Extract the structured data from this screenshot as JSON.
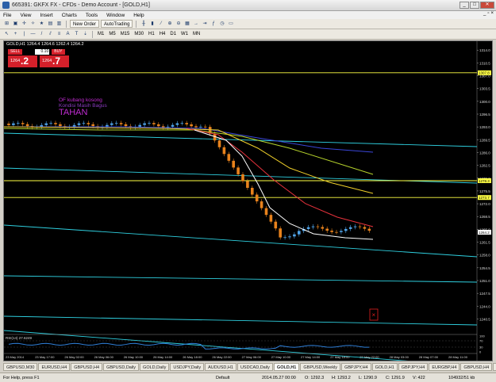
{
  "window": {
    "title": "665391: GKFX FX - CFDs - Demo Account - [GOLD,H1]",
    "min_icon": "minimize-icon",
    "max_icon": "maximize-icon",
    "close_icon": "close-icon"
  },
  "menu": [
    "File",
    "View",
    "Insert",
    "Charts",
    "Tools",
    "Window",
    "Help"
  ],
  "toolbar1": {
    "new_order": "New Order",
    "autotrading": "AutoTrading"
  },
  "timeframes": [
    "M1",
    "M5",
    "M15",
    "M30",
    "H1",
    "H4",
    "D1",
    "W1",
    "MN"
  ],
  "chart": {
    "header": "GOLD,H1  1264.4 1264.6 1262.4 1264.2",
    "one_click": {
      "sell_label": "SELL",
      "buy_label": "BUY",
      "lot": "0.10",
      "sell_small": "1264",
      "sell_big": ".2",
      "buy_small": "1264",
      "buy_big": ".7"
    },
    "annotations": [
      {
        "text": "OF kubang kosong",
        "color": "#c02bd2"
      },
      {
        "text": "Kondisi Masih Bagus",
        "color": "#8a3cc0"
      },
      {
        "text": "TAHAN",
        "color": "#c02bd2"
      }
    ],
    "price_labels": [
      "1314.0",
      "1310.5",
      "1307.0",
      "1303.5",
      "1300.0",
      "1296.5",
      "1293.0",
      "1289.5",
      "1286.0",
      "1282.5",
      "1279.0",
      "1275.5",
      "1272.0",
      "1268.5",
      "1265.0",
      "1261.5",
      "1258.0",
      "1254.5",
      "1251.0",
      "1247.5",
      "1244.0",
      "1240.5"
    ],
    "highlight_prices": [
      {
        "text": "1307.8",
        "color": "#ffff44"
      },
      {
        "text": "1278.3",
        "color": "#ffff44"
      },
      {
        "text": "1273.7",
        "color": "#ffff44"
      },
      {
        "text": "1264.2",
        "color": "#ffffff"
      }
    ],
    "time_labels": [
      "23 May 2014",
      "23 May 17:00",
      "26 May 02:00",
      "26 May 06:00",
      "26 May 10:00",
      "26 May 14:00",
      "26 May 18:00",
      "26 May 22:00",
      "27 May 06:00",
      "27 May 10:00",
      "27 May 14:00",
      "27 May 18:00",
      "27 May 22:00",
      "28 May 03:00",
      "28 May 07:00",
      "28 May 11:00"
    ],
    "rsi_label": "RSI(14) 27.6249",
    "rsi_levels": [
      "100",
      "70",
      "30",
      "0"
    ]
  },
  "tabs": [
    "GBPUSD,M30",
    "EURUSD,H4",
    "GBPUSD,H4",
    "GBPUSD,Daily",
    "GOLD,Daily",
    "USDJPY,Daily",
    "AUDUSD,H1",
    "USDCAD,Daily",
    "GOLD,H1",
    "GBPUSD,Weekly",
    "GBPJPY,H4",
    "GOLD,H1",
    "GBPJPY,H4",
    "EURGBP,H4",
    "GBPUSD,H4",
    "GC"
  ],
  "active_tab_index": 8,
  "status": {
    "help": "For Help, press F1",
    "profile": "Default",
    "datetime": "2014.05.27 00:00",
    "open": "O: 1292.3",
    "high": "H: 1293.2",
    "low": "L: 1290.9",
    "close": "C: 1291.9",
    "volume": "V: 422",
    "traffic": "104932/51 kb"
  },
  "colors": {
    "bg": "#000000",
    "bull": "#4fa3e8",
    "bear": "#e8821c",
    "ma_white": "#ffffff",
    "ma_red": "#e8323c",
    "ma_yellow": "#f0d02a",
    "ma_green": "#b7d42c",
    "ma_blue": "#3a46d8",
    "cyan": "#2fd0e0",
    "level": "#ffff44"
  }
}
